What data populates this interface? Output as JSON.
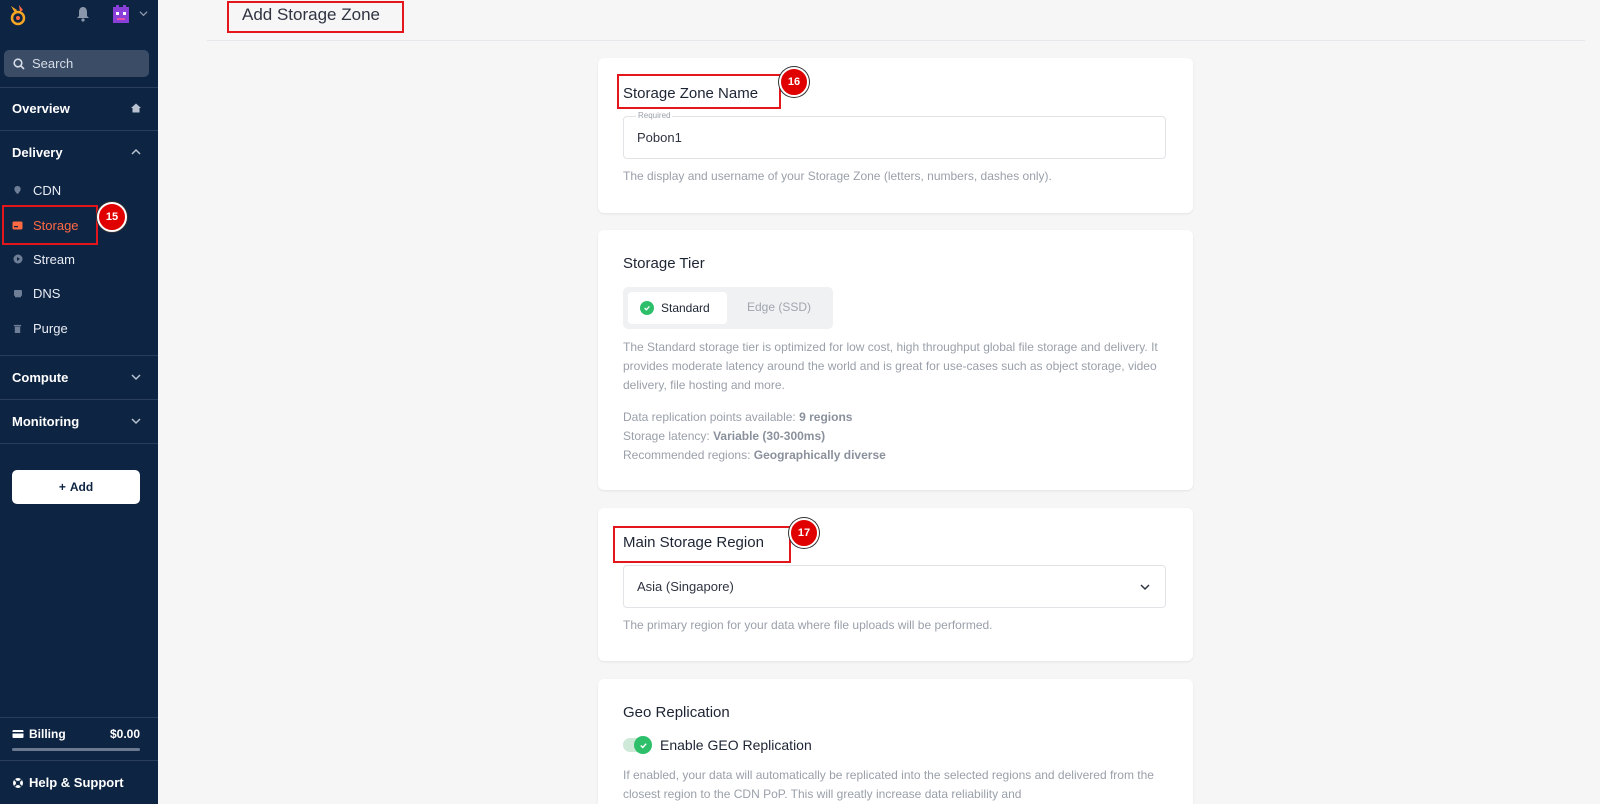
{
  "sidebar": {
    "search_placeholder": "Search",
    "overview": "Overview",
    "delivery": "Delivery",
    "items": [
      {
        "label": "CDN"
      },
      {
        "label": "Storage"
      },
      {
        "label": "Stream"
      },
      {
        "label": "DNS"
      },
      {
        "label": "Purge"
      }
    ],
    "compute": "Compute",
    "monitoring": "Monitoring",
    "add_label": "Add",
    "billing_label": "Billing",
    "billing_amount": "$0.00",
    "help_label": "Help & Support"
  },
  "markers": {
    "storage": "15",
    "zone_name": "16",
    "region": "17"
  },
  "page": {
    "title": "Add Storage Zone"
  },
  "zone_name": {
    "title": "Storage Zone Name",
    "field_label": "Required",
    "value": "Pobon1",
    "help": "The display and username of your Storage Zone (letters, numbers, dashes only)."
  },
  "tier": {
    "title": "Storage Tier",
    "standard": "Standard",
    "edge": "Edge (SSD)",
    "description": "The Standard storage tier is optimized for low cost, high throughput global file storage and delivery. It provides moderate latency around the world and is great for use-cases such as object storage, video delivery, file hosting and more.",
    "rep_label": "Data replication points available: ",
    "rep_value": "9 regions",
    "latency_label": "Storage latency: ",
    "latency_value": "Variable (30-300ms)",
    "regions_label": "Recommended regions: ",
    "regions_value": "Geographically diverse"
  },
  "region": {
    "title": "Main Storage Region",
    "selected": "Asia (Singapore)",
    "help": "The primary region for your data where file uploads will be performed."
  },
  "geo": {
    "title": "Geo Replication",
    "toggle_label": "Enable GEO Replication",
    "description": "If enabled, your data will automatically be replicated into the selected regions and delivered from the closest region to the CDN PoP. This will greatly increase data reliability and"
  },
  "colors": {
    "sidebar_bg": "#0e2443",
    "active": "#ff6a42",
    "success": "#2ebf6b",
    "annotation": "#e4161b"
  }
}
